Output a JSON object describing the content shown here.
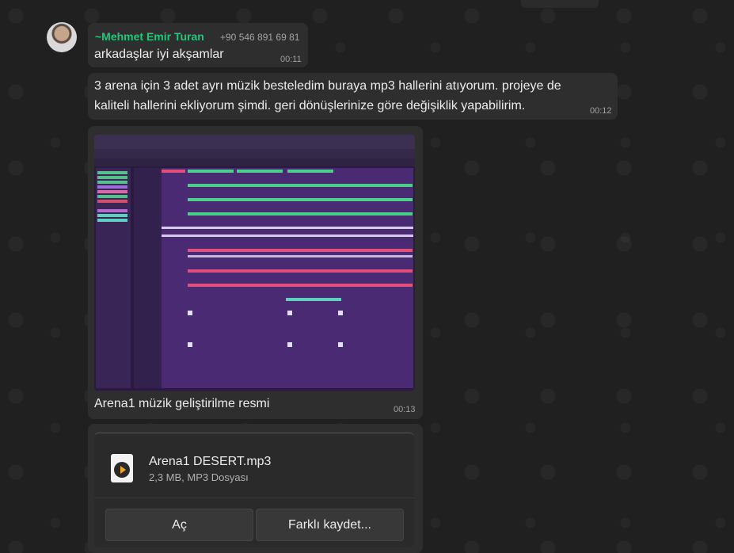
{
  "message1": {
    "sender": "~Mehmet Emir Turan",
    "phone": "+90 546 891 69 81",
    "text": "arkadaşlar iyi akşamlar",
    "time": "00:11"
  },
  "message2": {
    "line1": "3 arena için 3 adet ayrı müzik besteledim buraya mp3 hallerini atıyorum. projeye de",
    "line2": "kaliteli hallerini ekliyorum şimdi. geri dönüşlerinize göre değişiklik yapabilirim.",
    "time": "00:12"
  },
  "message3": {
    "caption": "Arena1 müzik geliştirilme resmi",
    "time": "00:13",
    "image_icon": "daw-screenshot-image"
  },
  "message4": {
    "file_name": "Arena1 DESERT.mp3",
    "file_meta": "2,3 MB, MP3 Dosyası",
    "open_label": "Aç",
    "save_label": "Farklı kaydet...",
    "file_icon": "audio-file-icon"
  },
  "colors": {
    "sender": "#25c47d",
    "bubble": "#2e2e2e",
    "background": "#202020"
  }
}
